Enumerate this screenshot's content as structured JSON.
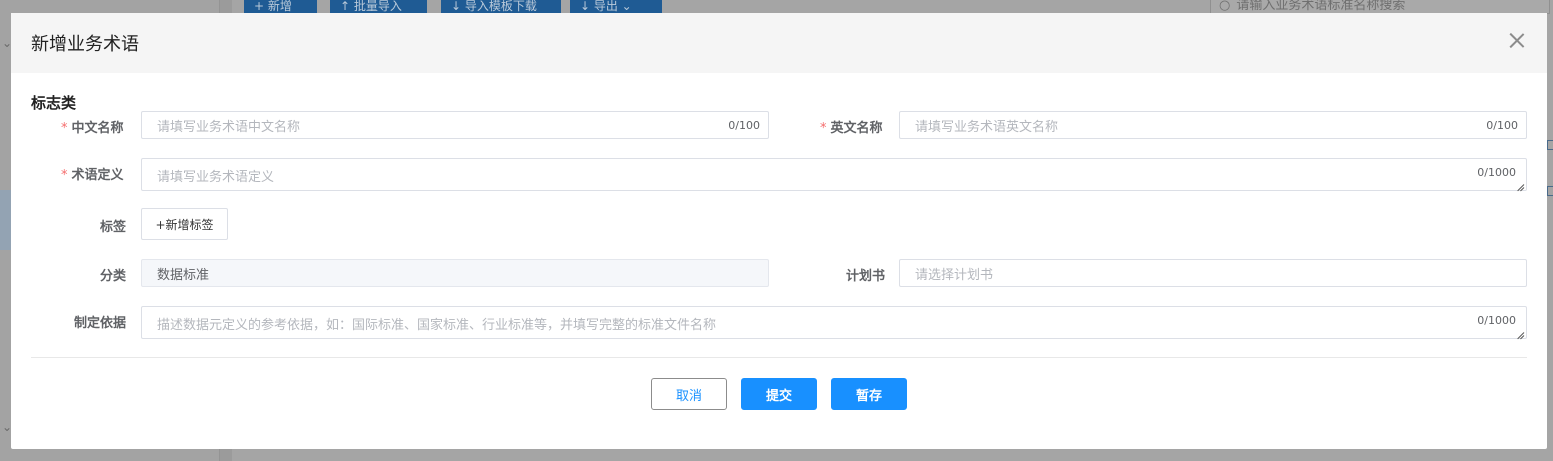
{
  "background": {
    "toolbar": [
      "+ 新增",
      "↑ 批量导入",
      "↓ 导入模板下载",
      "↓ 导出 ⌄"
    ],
    "search_placeholder": "请输入业务术语标准名称搜索",
    "search_icon": "search-icon"
  },
  "modal": {
    "title": "新增业务术语",
    "close_icon": "close-icon",
    "section_title": "标志类",
    "fields": {
      "cn_name": {
        "label": "中文名称",
        "required": true,
        "placeholder": "请填写业务术语中文名称",
        "count": "0/100"
      },
      "en_name": {
        "label": "英文名称",
        "required": true,
        "placeholder": "请填写业务术语英文名称",
        "count": "0/100"
      },
      "definition": {
        "label": "术语定义",
        "required": true,
        "placeholder": "请填写业务术语定义",
        "count": "0/1000"
      },
      "tags": {
        "label": "标签",
        "button": "+新增标签"
      },
      "category": {
        "label": "分类",
        "value": "数据标准"
      },
      "plan": {
        "label": "计划书",
        "placeholder": "请选择计划书"
      },
      "basis": {
        "label": "制定依据",
        "placeholder": "描述数据元定义的参考依据，如：国际标准、国家标准、行业标准等，并填写完整的标准文件名称",
        "count": "0/1000"
      }
    },
    "buttons": {
      "cancel": "取消",
      "submit": "提交",
      "save_draft": "暂存"
    },
    "colors": {
      "primary": "#1890ff",
      "required": "#f56c6c",
      "header_bg": "#f5f5f5"
    }
  }
}
